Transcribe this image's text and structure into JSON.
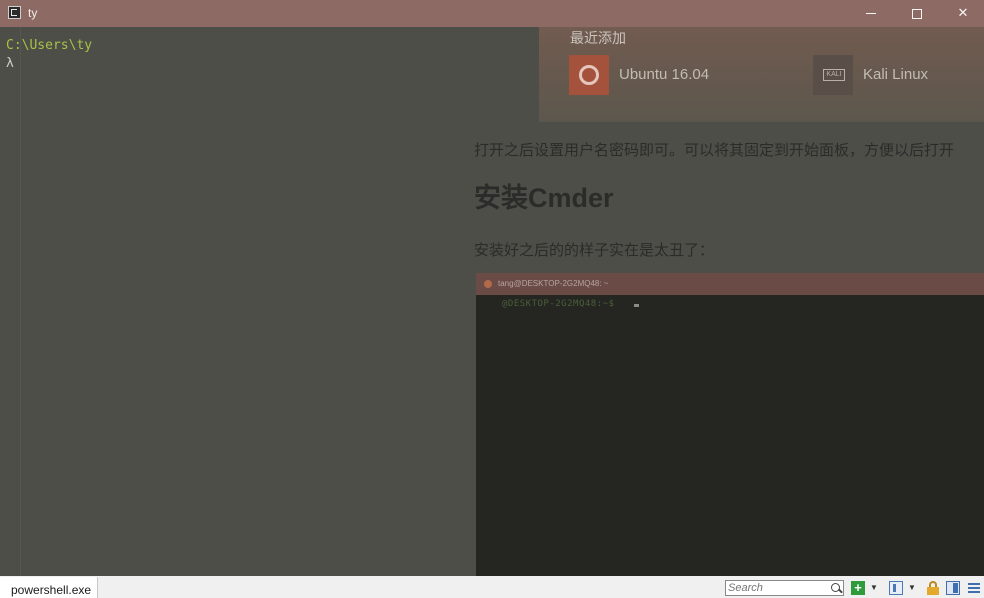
{
  "window": {
    "title": "ty",
    "minimize_label": "",
    "maximize_label": "",
    "close_label": "✕"
  },
  "terminal": {
    "path_line": "C:\\Users\\ty",
    "prompt_symbol": "λ"
  },
  "background_page": {
    "recent_label": "最近添加",
    "apps": [
      {
        "name": "Ubuntu 16.04",
        "icon": "ubuntu-icon"
      },
      {
        "name": "Kali Linux",
        "icon": "kali-icon",
        "icon_text": "KALI"
      }
    ],
    "paragraph1": "打开之后设置用户名密码即可。可以将其固定到开始面板，方便以后打开",
    "heading": "安装Cmder",
    "paragraph2": "安装好之后的的样子实在是太丑了：",
    "embedded_shot": {
      "title": "tang@DESKTOP-2G2MQ48: ~",
      "prompt": "@DESKTOP-2G2MQ48:~$"
    }
  },
  "statusbar": {
    "tab_label": "powershell.exe",
    "search_placeholder": "Search",
    "icons": [
      "plus-icon",
      "chevron-down-icon",
      "panes-icon",
      "chevron-down-icon",
      "lock-icon",
      "layout-icon",
      "menu-icon"
    ]
  },
  "colors": {
    "titlebar": "#8d6a63",
    "terminal_bg": "#4d4e48",
    "path_green": "#a7c245",
    "statusbar": "#f0f0f0"
  }
}
